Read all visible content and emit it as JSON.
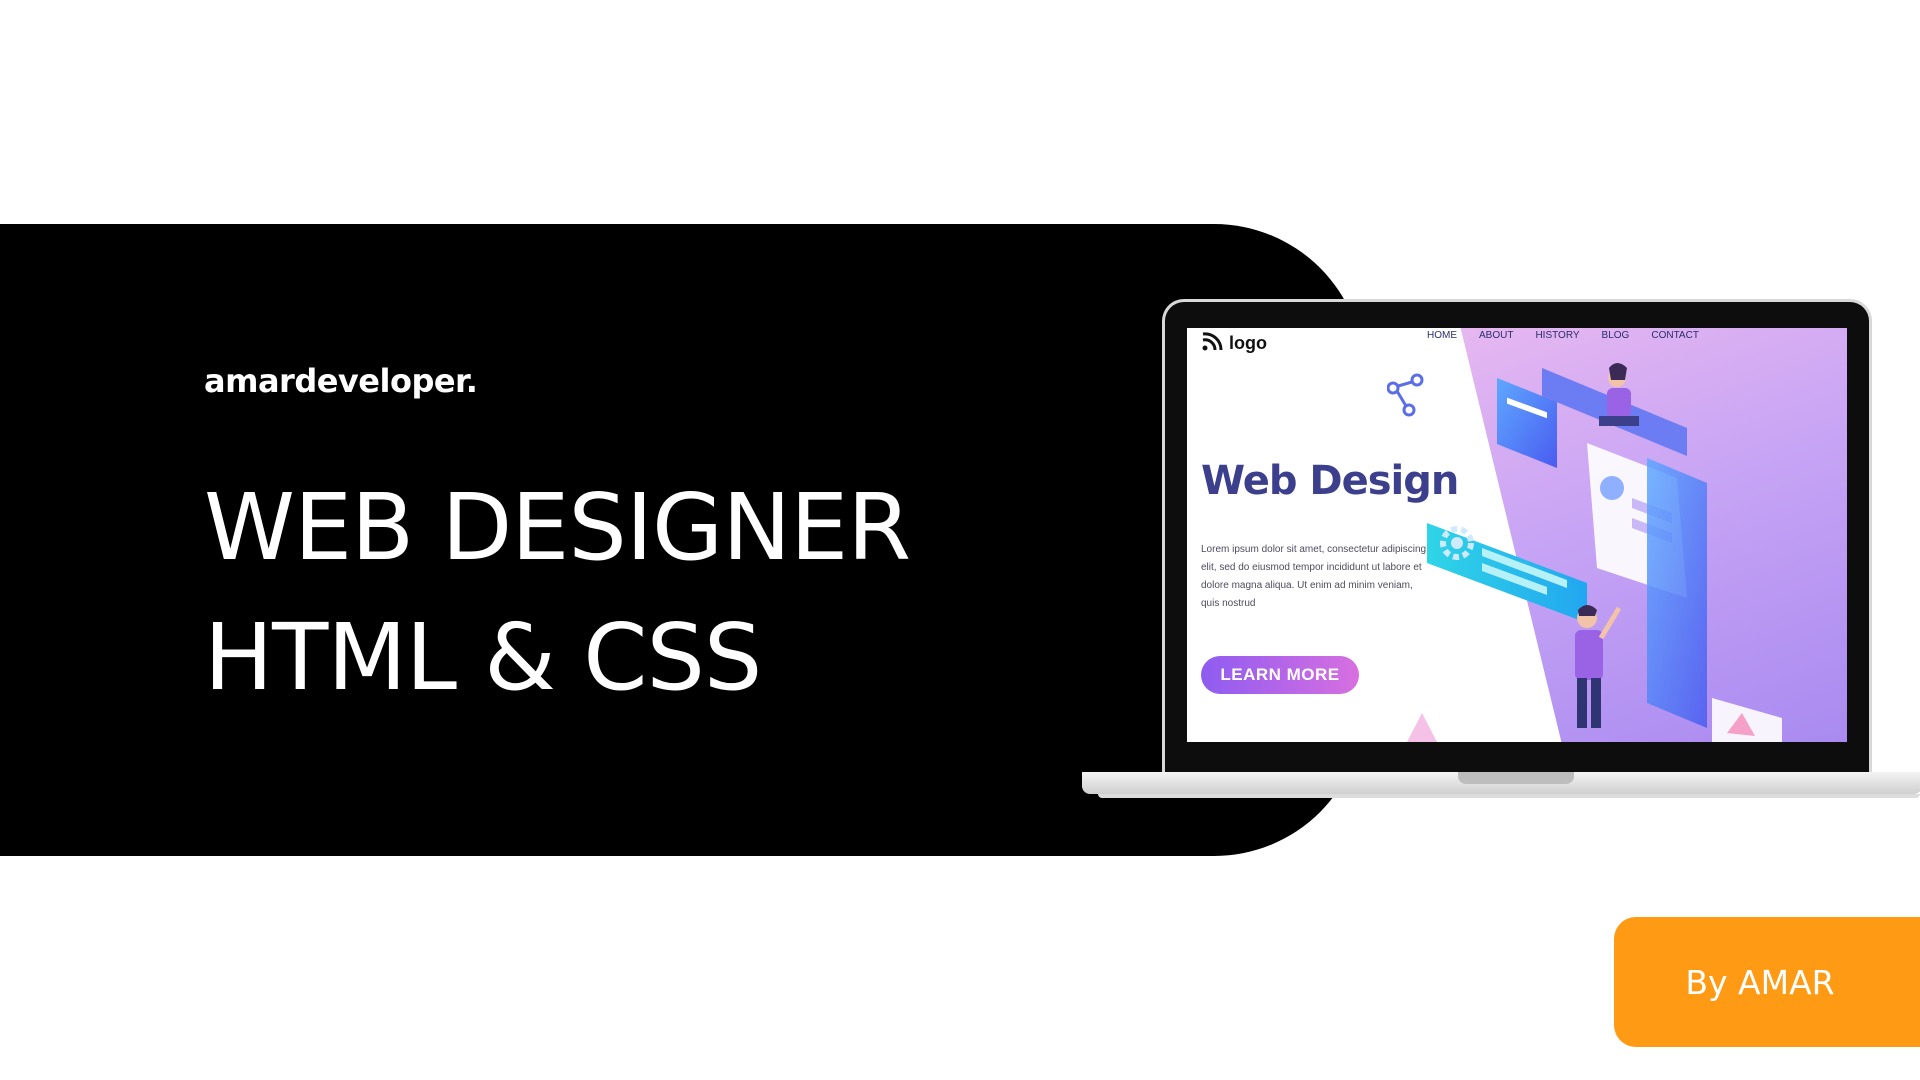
{
  "brand": "amardeveloper.",
  "headline": {
    "line1": "WEB DESIGNER",
    "line2": "HTML & CSS"
  },
  "screen": {
    "logo": "logo",
    "nav": [
      "HOME",
      "ABOUT",
      "HISTORY",
      "BLOG",
      "CONTACT"
    ],
    "title": "Web Design",
    "body": "Lorem ipsum dolor sit amet, consectetur adipiscing elit, sed do eiusmod tempor incididunt ut labore et dolore magna aliqua. Ut enim ad minim veniam, quis nostrud",
    "cta": "LEARN MORE"
  },
  "author": "By AMAR",
  "colors": {
    "panel": "#000000",
    "accent_orange": "#ff9a14",
    "screen_title": "#3b3f8c",
    "cta_gradient": [
      "#8e5cf0",
      "#d86fe0"
    ]
  },
  "icons": [
    "wifi-logo-icon",
    "share-icon",
    "gear-icon"
  ]
}
